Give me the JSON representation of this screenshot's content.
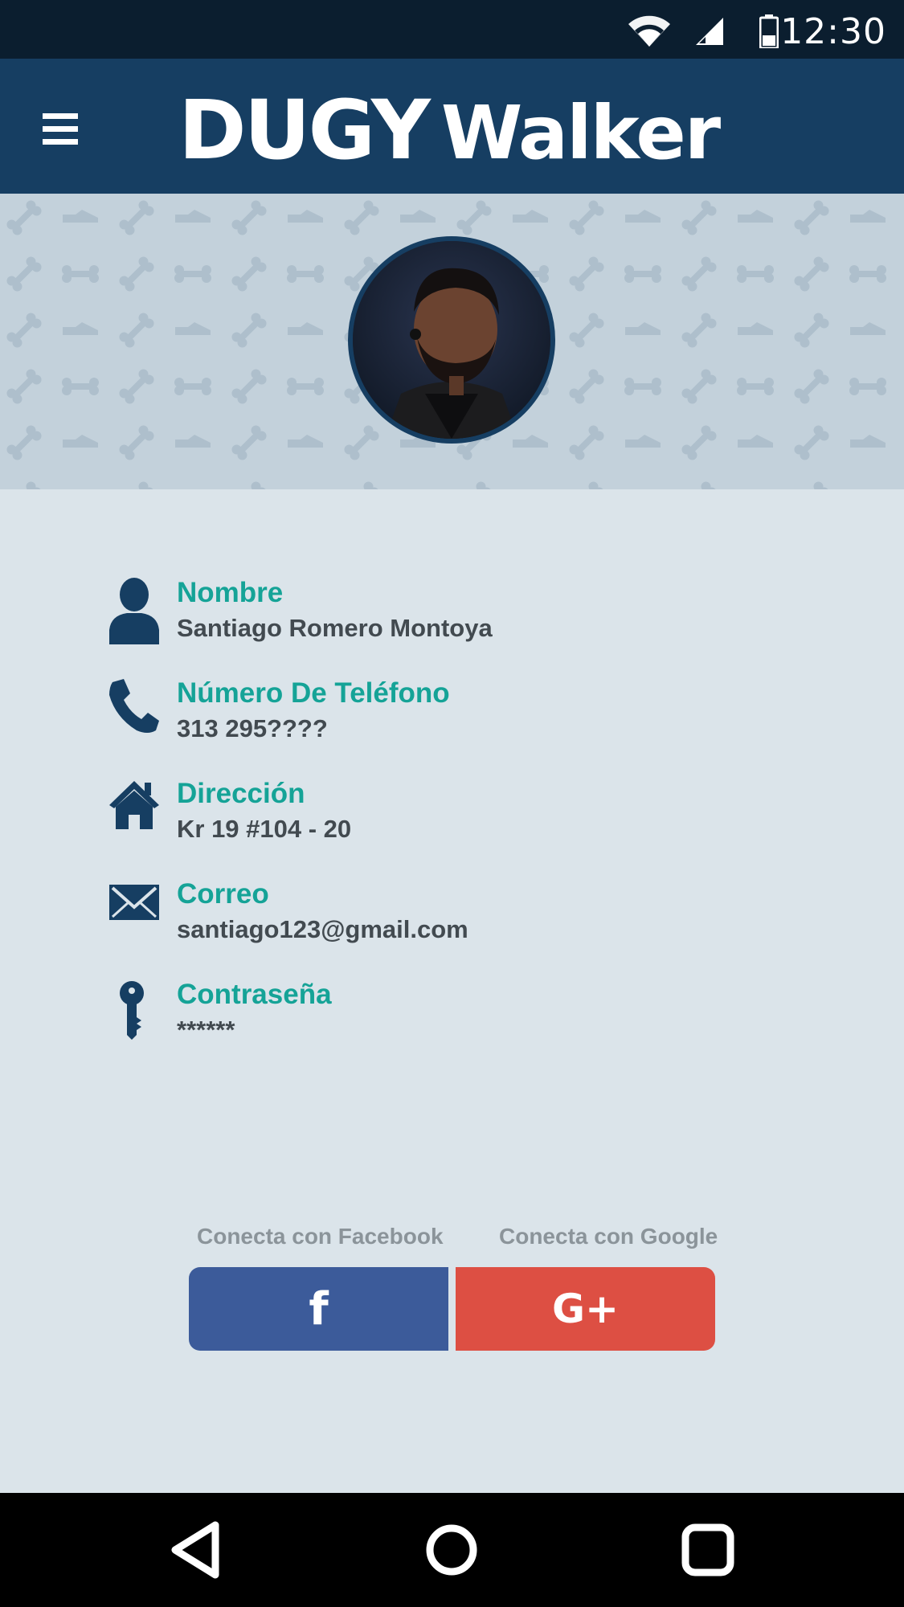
{
  "status_bar": {
    "time": "12:30",
    "icons": [
      "wifi-icon",
      "signal-icon",
      "battery-icon"
    ]
  },
  "app_bar": {
    "brand_part1": "DUGY",
    "brand_part2": "Walker",
    "menu_icon": "hamburger-menu-icon"
  },
  "profile": {
    "avatar_icon": "profile-photo"
  },
  "fields": [
    {
      "icon": "user-icon",
      "label": "Nombre",
      "value": "Santiago Romero Montoya"
    },
    {
      "icon": "phone-icon",
      "label": "Número De Teléfono",
      "value": "313 295????"
    },
    {
      "icon": "home-icon",
      "label": "Dirección",
      "value": "Kr 19 #104 - 20"
    },
    {
      "icon": "envelope-icon",
      "label": "Correo",
      "value": "santiago123@gmail.com"
    },
    {
      "icon": "key-icon",
      "label": "Contraseña",
      "value": "******"
    }
  ],
  "social": {
    "facebook_caption": "Conecta con Facebook",
    "google_caption": "Conecta con Google",
    "facebook_glyph": "f",
    "google_glyph": "G+",
    "facebook_color": "#3c5b9a",
    "google_color": "#dd4f43"
  },
  "colors": {
    "app_bar": "#163e62",
    "status_bar": "#0b1e2f",
    "label": "#15a397",
    "value": "#424a50",
    "background": "#dbe4ea"
  },
  "nav_bar": {
    "icons": [
      "back-triangle-icon",
      "home-circle-icon",
      "recents-square-icon"
    ]
  }
}
